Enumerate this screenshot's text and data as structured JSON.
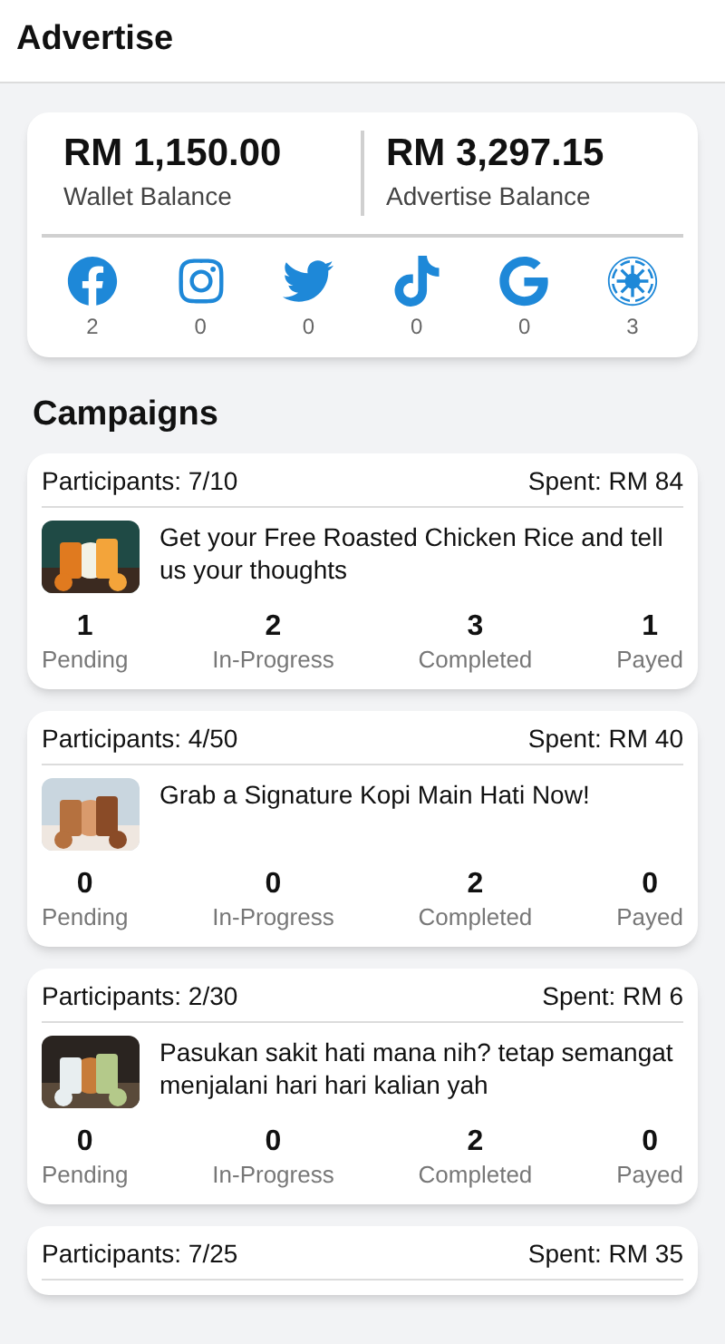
{
  "header": {
    "title": "Advertise"
  },
  "balances": [
    {
      "amount": "RM 1,150.00",
      "label": "Wallet Balance"
    },
    {
      "amount": "RM 3,297.15",
      "label": "Advertise Balance"
    }
  ],
  "platforms": [
    {
      "kind": "facebook",
      "count": "2"
    },
    {
      "kind": "instagram",
      "count": "0"
    },
    {
      "kind": "twitter",
      "count": "0"
    },
    {
      "kind": "tiktok",
      "count": "0"
    },
    {
      "kind": "google",
      "count": "0"
    },
    {
      "kind": "emblem",
      "count": "3"
    }
  ],
  "section_title": "Campaigns",
  "campaigns": [
    {
      "participants": "Participants: 7/10",
      "spent": "Spent: RM 84",
      "title": "Get your Free Roasted Chicken Rice and tell us your thoughts",
      "kind": "picture",
      "stats": [
        {
          "value": "1",
          "label": "Pending"
        },
        {
          "value": "2",
          "label": "In-Progress"
        },
        {
          "value": "3",
          "label": "Completed"
        },
        {
          "value": "1",
          "label": "Payed"
        }
      ]
    },
    {
      "participants": "Participants: 4/50",
      "spent": "Spent: RM 40",
      "title": "Grab a Signature Kopi Main Hati Now!",
      "kind": "picture",
      "stats": [
        {
          "value": "0",
          "label": "Pending"
        },
        {
          "value": "0",
          "label": "In-Progress"
        },
        {
          "value": "2",
          "label": "Completed"
        },
        {
          "value": "0",
          "label": "Payed"
        }
      ]
    },
    {
      "participants": "Participants: 2/30",
      "spent": "Spent: RM 6",
      "title": "Pasukan sakit hati mana nih? tetap semangat menjalani hari hari kalian yah",
      "kind": "picture",
      "stats": [
        {
          "value": "0",
          "label": "Pending"
        },
        {
          "value": "0",
          "label": "In-Progress"
        },
        {
          "value": "2",
          "label": "Completed"
        },
        {
          "value": "0",
          "label": "Payed"
        }
      ]
    },
    {
      "participants": "Participants: 7/25",
      "spent": "Spent: RM 35"
    }
  ]
}
